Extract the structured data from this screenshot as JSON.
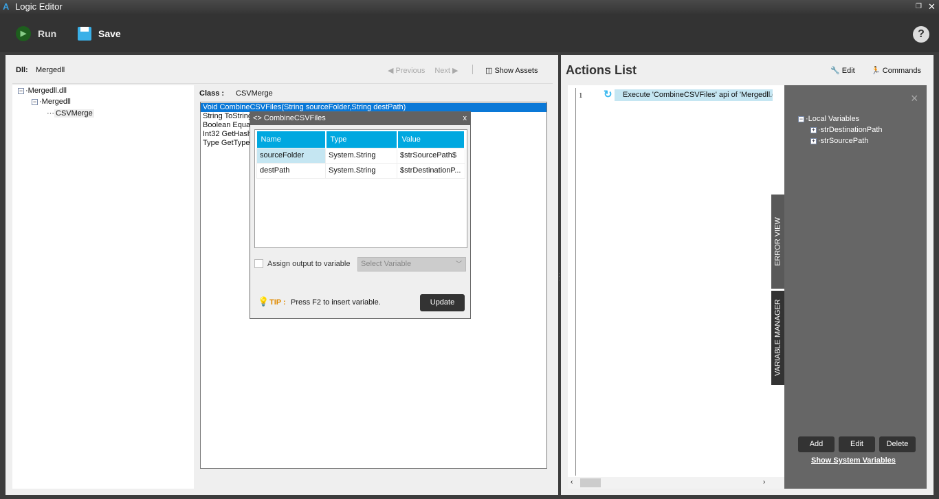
{
  "window": {
    "title": "Logic Editor"
  },
  "toolbar": {
    "run": "Run",
    "save": "Save",
    "help": "?"
  },
  "dll": {
    "label": "Dll:",
    "value": "Mergedll"
  },
  "nav": {
    "previous": "Previous",
    "next": "Next",
    "show_assets": "Show Assets"
  },
  "tree": {
    "root": "Mergedll.dll",
    "ns": "Mergedll",
    "cls": "CSVMerge"
  },
  "class": {
    "label": "Class :",
    "value": "CSVMerge"
  },
  "methods": [
    "Void CombineCSVFiles(String sourceFolder,String destPath)",
    "String ToString()",
    "Boolean Equals(Object obj)",
    "Int32 GetHashCode()",
    "Type GetType()"
  ],
  "popup": {
    "title": "<> CombineCSVFiles",
    "close": "x",
    "columns": [
      "Name",
      "Type",
      "Value"
    ],
    "rows": [
      [
        "sourceFolder",
        "System.String",
        "$strSourcePath$"
      ],
      [
        "destPath",
        "System.String",
        "$strDestinationP..."
      ]
    ],
    "assign_label": "Assign output to variable",
    "select_placeholder": "Select Variable",
    "tip_label": "TIP :",
    "tip_text": "Press F2 to insert variable.",
    "update": "Update"
  },
  "actions": {
    "title": "Actions List",
    "edit": "Edit",
    "commands": "Commands",
    "items": [
      {
        "num": "1",
        "text": "Execute 'CombineCSVFiles' api of 'Mergedll.dll"
      }
    ]
  },
  "varmgr": {
    "root": "Local Variables",
    "vars": [
      "strDestinationPath",
      "strSourcePath"
    ],
    "add": "Add",
    "edit": "Edit",
    "delete": "Delete",
    "show_system": "Show System Variables",
    "tab_error": "ERROR VIEW",
    "tab_var": "VARIABLE MANAGER",
    "close": "×"
  }
}
